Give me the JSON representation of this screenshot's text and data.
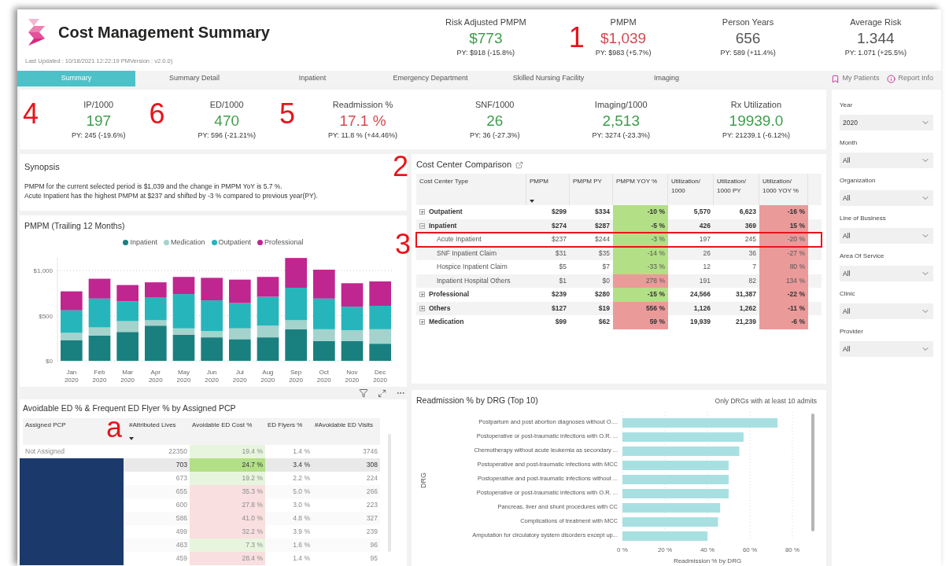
{
  "header": {
    "title": "Cost Management Summary",
    "last_updated": "Last Updated : 10/18/2021 12:22:19 PMVersion : v2.0.0)"
  },
  "top_kpis": [
    {
      "label": "Risk Adjusted PMPM",
      "value": "$773",
      "color": "#3f9d4c",
      "py": "PY: $918 (-15.8%)"
    },
    {
      "label": "PMPM",
      "value": "$1,039",
      "color": "#d24a50",
      "py": "PY: $983 (+5.7%)",
      "marker": "1"
    },
    {
      "label": "Person Years",
      "value": "656",
      "color": "#555555",
      "py": "PY: 589 (+11.4%)"
    },
    {
      "label": "Average Risk",
      "value": "1.344",
      "color": "#555555",
      "py": "PY: 1.071 (+25.5%)"
    }
  ],
  "tabs": [
    {
      "label": "Summary",
      "selected": true
    },
    {
      "label": "Summary Detail",
      "selected": false
    },
    {
      "label": "Inpatient",
      "selected": false
    },
    {
      "label": "Emergency Department",
      "selected": false
    },
    {
      "label": "Skilled Nursing Facility",
      "selected": false
    },
    {
      "label": "Imaging",
      "selected": false
    }
  ],
  "header_links": [
    {
      "label": "My Patients",
      "kind": "bookmark"
    },
    {
      "label": "Report Info",
      "kind": "info"
    }
  ],
  "kpis": [
    {
      "label": "IP/1000",
      "value": "197",
      "color": "#3f9d4c",
      "py": "PY: 245 (-19.6%)",
      "marker": "4"
    },
    {
      "label": "ED/1000",
      "value": "470",
      "color": "#3f9d4c",
      "py": "PY: 596 (-21.21%)",
      "marker": "6"
    },
    {
      "label": "Readmission %",
      "value": "17.1 %",
      "color": "#d24a50",
      "py": "PY: 11.8 % (+44.46%)",
      "marker": "5"
    },
    {
      "label": "SNF/1000",
      "value": "26",
      "color": "#3f9d4c",
      "py": "PY: 36 (-27.3%)"
    },
    {
      "label": "Imaging/1000",
      "value": "2,513",
      "color": "#3f9d4c",
      "py": "PY: 3274 (-23.3%)"
    },
    {
      "label": "Rx Utilization",
      "value": "19939.0",
      "color": "#3f9d4c",
      "py": "PY: 21239.1 (-6.12%)"
    }
  ],
  "synopsis": {
    "title": "Synopsis",
    "lines": [
      "PMPM for the current selected period is $1,039 and the change in PMPM YoY is 5.7 %.",
      "Acute Inpatient has the highest PMPM at $237 and shifted by -3 % compared to previous year(PY)."
    ]
  },
  "pmpm_chart": {
    "title": "PMPM (Trailing 12 Months)",
    "chart_data": {
      "type": "bar",
      "stacked": true,
      "legend": "top",
      "grid": true,
      "categories": [
        "Jan 2020",
        "Feb 2020",
        "Mar 2020",
        "Apr 2020",
        "May 2020",
        "Jun 2020",
        "Jul 2020",
        "Aug 2020",
        "Sep 2020",
        "Oct 2020",
        "Nov 2020",
        "Dec 2020"
      ],
      "ylim": [
        0,
        1150
      ],
      "yticks": [
        {
          "value": 0,
          "label": "$0"
        },
        {
          "value": 500,
          "label": "$500"
        },
        {
          "value": 1000,
          "label": "$1,000"
        }
      ],
      "series": [
        {
          "name": "Inpatient",
          "color": "#1a7f7f",
          "values": [
            230,
            280,
            320,
            390,
            290,
            260,
            240,
            260,
            350,
            220,
            220,
            190
          ]
        },
        {
          "name": "Medication",
          "color": "#a3d3cc",
          "values": [
            80,
            90,
            120,
            60,
            70,
            70,
            120,
            130,
            100,
            130,
            120,
            160
          ]
        },
        {
          "name": "Outpatient",
          "color": "#27b5bc",
          "values": [
            250,
            320,
            220,
            250,
            380,
            340,
            280,
            320,
            360,
            340,
            260,
            260
          ]
        },
        {
          "name": "Professional",
          "color": "#c0268f",
          "values": [
            210,
            220,
            180,
            170,
            190,
            250,
            260,
            220,
            330,
            320,
            260,
            270
          ]
        }
      ]
    }
  },
  "cost_center": {
    "title": "Cost Center Comparison",
    "marker": "2",
    "columns": [
      {
        "label": "Cost Center Type",
        "sorted": false
      },
      {
        "label": "PMPM",
        "sorted": true
      },
      {
        "label": "PMPM PY",
        "sorted": false
      },
      {
        "label": "PMPM YOY %",
        "sorted": false
      },
      {
        "label": "Utilization/ 1000",
        "sorted": false
      },
      {
        "label": "Utilization/ 1000 PY",
        "sorted": false
      },
      {
        "label": "Utilization/ 1000 YOY %",
        "sorted": false
      }
    ],
    "rows": [
      {
        "name": "Outpatient",
        "expanded": false,
        "pmpm": "$299",
        "pmpm_py": "$334",
        "pmpm_yoy": {
          "text": "-10 %",
          "color": "#b3df86"
        },
        "util": "5,570",
        "util_py": "6,623",
        "util_yoy": {
          "text": "-16 %",
          "color": "#eb9a9a"
        }
      },
      {
        "name": "Inpatient",
        "expanded": true,
        "pmpm": "$274",
        "pmpm_py": "$287",
        "pmpm_yoy": {
          "text": "-5 %",
          "color": "#b3df86"
        },
        "util": "426",
        "util_py": "369",
        "util_yoy": {
          "text": "15 %",
          "color": "#eb9a9a"
        },
        "children": [
          {
            "name": "Acute Inpatient",
            "highlighted": true,
            "marker": "3",
            "pmpm": "$237",
            "pmpm_py": "$244",
            "pmpm_yoy": {
              "text": "-3 %",
              "color": "#b3df86"
            },
            "util": "197",
            "util_py": "245",
            "util_yoy": {
              "text": "-20 %",
              "color": "#eb9a9a"
            }
          },
          {
            "name": "SNF Inpatient Claim",
            "highlighted": false,
            "pmpm": "$31",
            "pmpm_py": "$35",
            "pmpm_yoy": {
              "text": "-14 %",
              "color": "#b3df86"
            },
            "util": "26",
            "util_py": "36",
            "util_yoy": {
              "text": "-27 %",
              "color": "#eb9a9a"
            }
          },
          {
            "name": "Hospice Inpatient Claim",
            "highlighted": false,
            "pmpm": "$5",
            "pmpm_py": "$7",
            "pmpm_yoy": {
              "text": "-33 %",
              "color": "#b3df86"
            },
            "util": "12",
            "util_py": "7",
            "util_yoy": {
              "text": "80 %",
              "color": "#eb9a9a"
            }
          },
          {
            "name": "Inpatient Hospital Others",
            "highlighted": false,
            "pmpm": "$1",
            "pmpm_py": "$0",
            "pmpm_yoy": {
              "text": "278 %",
              "color": "#eb9a9a"
            },
            "util": "191",
            "util_py": "82",
            "util_yoy": {
              "text": "134 %",
              "color": "#eb9a9a"
            }
          }
        ]
      },
      {
        "name": "Professional",
        "expanded": false,
        "pmpm": "$239",
        "pmpm_py": "$280",
        "pmpm_yoy": {
          "text": "-15 %",
          "color": "#b3df86"
        },
        "util": "24,566",
        "util_py": "31,387",
        "util_yoy": {
          "text": "-22 %",
          "color": "#eb9a9a"
        }
      },
      {
        "name": "Others",
        "expanded": false,
        "pmpm": "$127",
        "pmpm_py": "$19",
        "pmpm_yoy": {
          "text": "556 %",
          "color": "#eb9a9a"
        },
        "util": "1,126",
        "util_py": "1,262",
        "util_yoy": {
          "text": "-11 %",
          "color": "#eb9a9a"
        }
      },
      {
        "name": "Medication",
        "expanded": false,
        "pmpm": "$99",
        "pmpm_py": "$62",
        "pmpm_yoy": {
          "text": "59 %",
          "color": "#eb9a9a"
        },
        "util": "19,939",
        "util_py": "21,239",
        "util_yoy": {
          "text": "-6 %",
          "color": "#eb9a9a"
        }
      }
    ]
  },
  "ed_table": {
    "title": "Avoidable ED % & Frequent ED Flyer % by Assigned PCP",
    "marker": "a",
    "columns": [
      {
        "label": "Assigned PCP",
        "sorted": false
      },
      {
        "label": "#Attributed Lives",
        "sorted": true
      },
      {
        "label": "Avoidable ED Cost %",
        "sorted": false
      },
      {
        "label": "ED Flyers %",
        "sorted": false
      },
      {
        "label": "#Avoidable ED Visits",
        "sorted": false
      }
    ],
    "rows": [
      {
        "pcp": "Not Assigned",
        "redacted": false,
        "selected": false,
        "lives": "22350",
        "cost": {
          "text": "19.4 %",
          "color": "#e8f5de"
        },
        "flyers": "1.4 %",
        "visits": "3746"
      },
      {
        "redacted": true,
        "selected": true,
        "lives": "703",
        "cost": {
          "text": "24.7 %",
          "color": "#b3df86"
        },
        "flyers": "3.4 %",
        "visits": "308"
      },
      {
        "redacted": true,
        "selected": false,
        "lives": "673",
        "cost": {
          "text": "19.2 %",
          "color": "#e8f5de"
        },
        "flyers": "2.2 %",
        "visits": "224"
      },
      {
        "redacted": true,
        "selected": false,
        "lives": "655",
        "cost": {
          "text": "35.3 %",
          "color": "#f9dfdf"
        },
        "flyers": "5.0 %",
        "visits": "266"
      },
      {
        "redacted": true,
        "selected": false,
        "lives": "600",
        "cost": {
          "text": "27.8 %",
          "color": "#f9dfdf"
        },
        "flyers": "3.0 %",
        "visits": "223"
      },
      {
        "redacted": true,
        "selected": false,
        "lives": "586",
        "cost": {
          "text": "41.0 %",
          "color": "#f9dfdf"
        },
        "flyers": "4.8 %",
        "visits": "327"
      },
      {
        "redacted": true,
        "selected": false,
        "lives": "499",
        "cost": {
          "text": "32.2 %",
          "color": "#f9dfdf"
        },
        "flyers": "3.9 %",
        "visits": "239"
      },
      {
        "redacted": true,
        "selected": false,
        "lives": "463",
        "cost": {
          "text": "7.3 %",
          "color": "#e8f5de"
        },
        "flyers": "1.6 %",
        "visits": "96"
      },
      {
        "redacted": true,
        "selected": false,
        "lives": "459",
        "cost": {
          "text": "28.4 %",
          "color": "#f9dfdf"
        },
        "flyers": "1.4 %",
        "visits": "95"
      }
    ]
  },
  "drg_chart": {
    "title": "Readmission % by DRG (Top 10)",
    "note": "Only DRGs with at least 10 admits",
    "chart_data": {
      "type": "bar",
      "orientation": "horizontal",
      "grid": true,
      "xlabel": "Readmission % by DRG",
      "ylabel": "DRG",
      "categories": [
        "Postpartum and post abortion diagnoses without O....",
        "Postoperative or post-traumatic infections with O.R. ...",
        "Chemotherapy without acute leukemia as secondary ...",
        "Postoperative and post-traumatic infections with MCC",
        "Postoperative and post-traumatic infections without ...",
        "Postoperative or post-traumatic infections with O.R. ...",
        "Pancreas, liver and shunt procedures with CC",
        "Complications of treatment with MCC",
        "Amputation for circulatory system disorders except up..."
      ],
      "xlim": [
        0,
        80
      ],
      "xticks": [
        {
          "value": 0,
          "label": "0 %"
        },
        {
          "value": 20,
          "label": "20 %"
        },
        {
          "value": 40,
          "label": "40 %"
        },
        {
          "value": 60,
          "label": "60 %"
        },
        {
          "value": 80,
          "label": "80 %"
        }
      ],
      "series": [
        {
          "color": "#a8e0e2",
          "values": [
            73,
            57,
            55,
            50,
            50,
            50,
            46,
            45,
            40
          ]
        }
      ]
    }
  },
  "filters": [
    {
      "label": "Year",
      "value": "2020"
    },
    {
      "label": "Month",
      "value": "All"
    },
    {
      "label": "Organization",
      "value": "All"
    },
    {
      "label": "Line of Business",
      "value": "All"
    },
    {
      "label": "Area Of Service",
      "value": "All"
    },
    {
      "label": "Clinic",
      "value": "All"
    },
    {
      "label": "Provider",
      "value": "All"
    }
  ]
}
